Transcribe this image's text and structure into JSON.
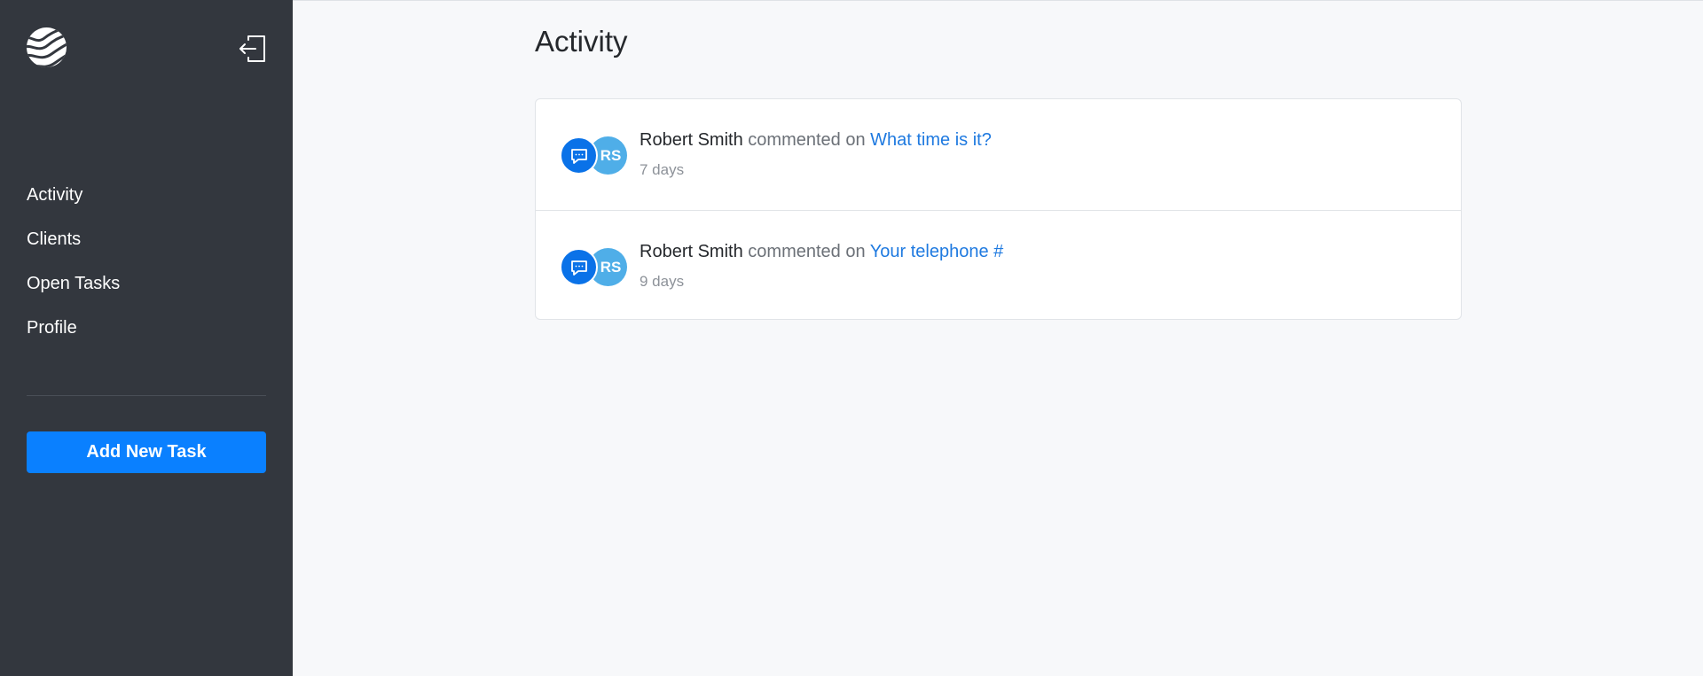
{
  "sidebar": {
    "logo_icon": "wave-logo-icon",
    "logout_icon": "logout-icon",
    "nav": [
      {
        "label": "Activity"
      },
      {
        "label": "Clients"
      },
      {
        "label": "Open Tasks"
      },
      {
        "label": "Profile"
      }
    ],
    "add_task_label": "Add New Task"
  },
  "main": {
    "title": "Activity",
    "activities": [
      {
        "badge_icon": "comment-icon",
        "avatar_initials": "RS",
        "author": "Robert Smith",
        "action": "commented on",
        "target": "What time is it?",
        "time": "7 days"
      },
      {
        "badge_icon": "comment-icon",
        "avatar_initials": "RS",
        "author": "Robert Smith",
        "action": "commented on",
        "target": "Your telephone #",
        "time": "9 days"
      }
    ]
  },
  "colors": {
    "sidebar_bg": "#33373e",
    "accent": "#0a80ff",
    "link": "#1f7ae0",
    "avatar_bg": "#4faee8"
  }
}
